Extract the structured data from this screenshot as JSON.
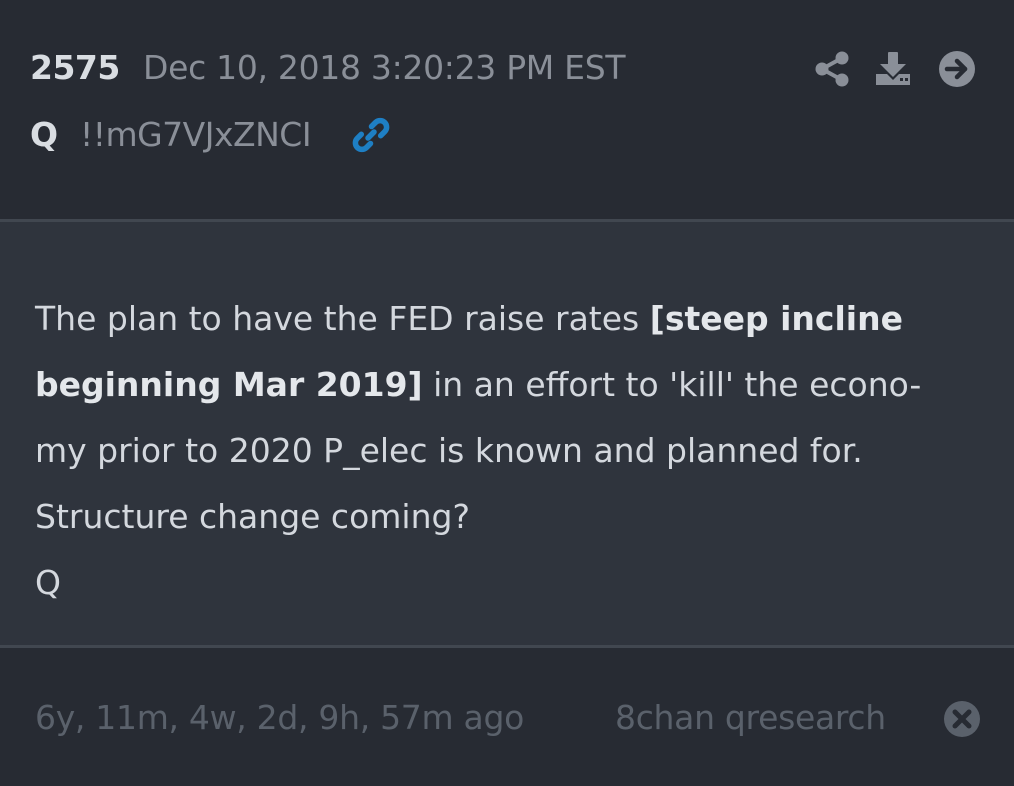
{
  "post": {
    "number": "2575",
    "date": "Dec 10, 2018 3:20:23 PM EST",
    "author": "Q",
    "tripcode": "!!mG7VJxZNCI",
    "message_lines": [
      {
        "before": "The plan to have the FED raise rates ",
        "bold": "[steep incline",
        "after": ""
      },
      {
        "before": "",
        "bold": "beginning Mar 2019]",
        "after": " in an effort to 'kill' the econo-"
      },
      {
        "before": "my prior to 2020 P_elec is known and planned for.",
        "bold": "",
        "after": ""
      },
      {
        "before": "Structure change coming?",
        "bold": "",
        "after": ""
      },
      {
        "before": "Q",
        "bold": "",
        "after": ""
      }
    ]
  },
  "footer": {
    "time_ago": "6y, 11m, 4w, 2d, 9h, 57m ago",
    "source": "8chan qresearch"
  },
  "icons": {
    "link": "link-icon",
    "share": "share-icon",
    "download": "download-icon",
    "navigate": "arrow-right-circle-icon",
    "close": "close-circle-icon"
  },
  "colors": {
    "background": "#272b33",
    "body_panel": "#2f343d",
    "divider": "#414750",
    "link_accent": "#1e7fc4",
    "icon_gray": "#8a8f98",
    "muted_text": "#5a616b"
  }
}
